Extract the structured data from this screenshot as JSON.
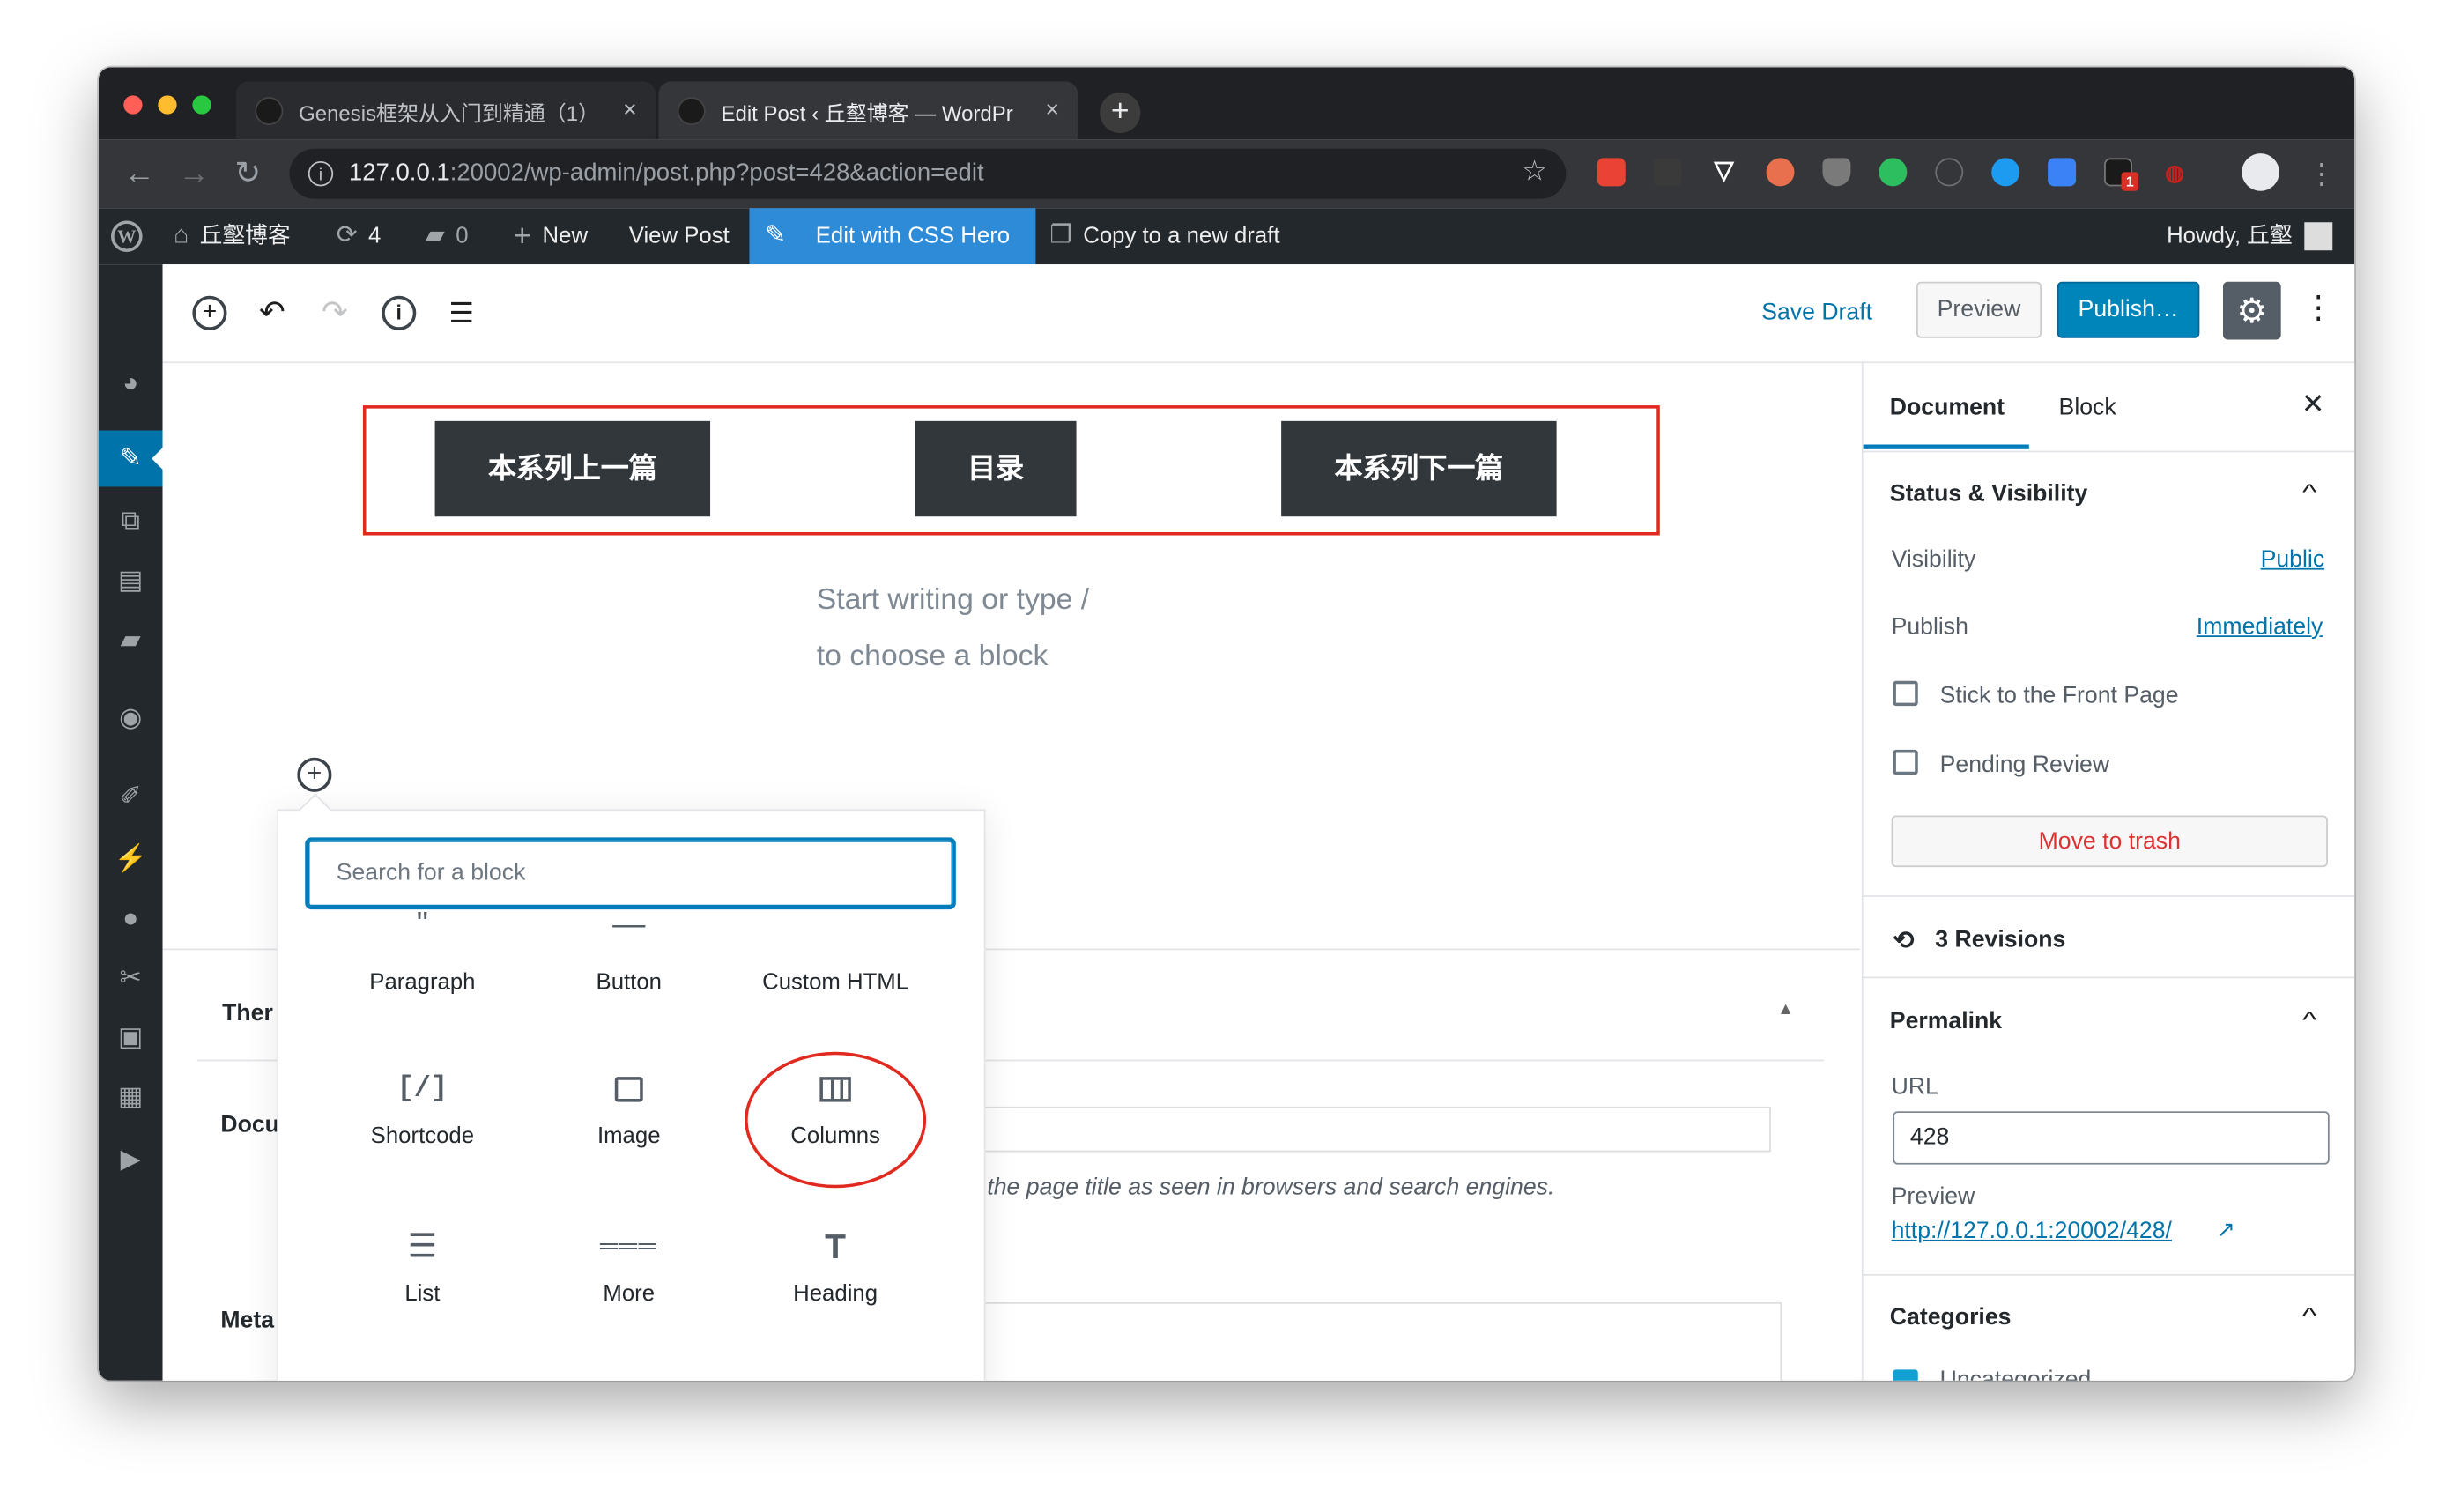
{
  "browser": {
    "tabs": [
      {
        "title": "Genesis框架从入门到精通（1）",
        "close": "×"
      },
      {
        "title": "Edit Post ‹ 丘壑博客 — WordPr",
        "close": "×"
      }
    ],
    "new_tab": "+",
    "address": {
      "host": "127.0.0.1",
      "path": ":20002/wp-admin/post.php?post=428&action=edit"
    },
    "ext_badge": "1"
  },
  "adminbar": {
    "site_name": "丘壑博客",
    "updates": "4",
    "comments": "0",
    "new_label": "New",
    "view_post": "View Post",
    "css_hero": "Edit with CSS Hero",
    "copy_draft": "Copy to a new draft",
    "howdy": "Howdy, 丘壑"
  },
  "editor_toolbar": {
    "save_draft": "Save Draft",
    "preview": "Preview",
    "publish": "Publish…"
  },
  "content": {
    "buttons": [
      "本系列上一篇",
      "目录",
      "本系列下一篇"
    ],
    "placeholder_line1": "Start writing or type /",
    "placeholder_line2": "to choose a block"
  },
  "metabox": {
    "label_theme": "Ther",
    "label_doc": "Docu",
    "label_meta": "Meta",
    "hint": "the page title as seen in browsers and search engines."
  },
  "inserter": {
    "search_placeholder": "Search for a block",
    "blocks": [
      {
        "label": "Paragraph",
        "icon": "paragraph-icon"
      },
      {
        "label": "Button",
        "icon": "button-icon"
      },
      {
        "label": "Custom HTML",
        "icon": "html-icon"
      },
      {
        "label": "Shortcode",
        "icon": "shortcode-icon",
        "glyph": "[/]"
      },
      {
        "label": "Image",
        "icon": "image-icon"
      },
      {
        "label": "Columns",
        "icon": "columns-icon"
      },
      {
        "label": "List",
        "icon": "list-icon"
      },
      {
        "label": "More",
        "icon": "more-icon"
      },
      {
        "label": "Heading",
        "icon": "heading-icon",
        "glyph": "T"
      }
    ]
  },
  "sidebar": {
    "tab_document": "Document",
    "tab_block": "Block",
    "status_title": "Status & Visibility",
    "visibility_label": "Visibility",
    "visibility_value": "Public",
    "publish_label": "Publish",
    "publish_value": "Immediately",
    "stick_label": "Stick to the Front Page",
    "pending_label": "Pending Review",
    "trash": "Move to trash",
    "revisions": "3 Revisions",
    "permalink_title": "Permalink",
    "url_label": "URL",
    "url_value": "428",
    "preview_label": "Preview",
    "preview_link": "http://127.0.0.1:20002/428/",
    "categories_title": "Categories",
    "category_first": "Uncategorized"
  },
  "colors": {
    "accent": "#0085ba",
    "admin_bar": "#23282d",
    "css_hero": "#2d8bd8",
    "annotation_red": "#e02a1f"
  }
}
